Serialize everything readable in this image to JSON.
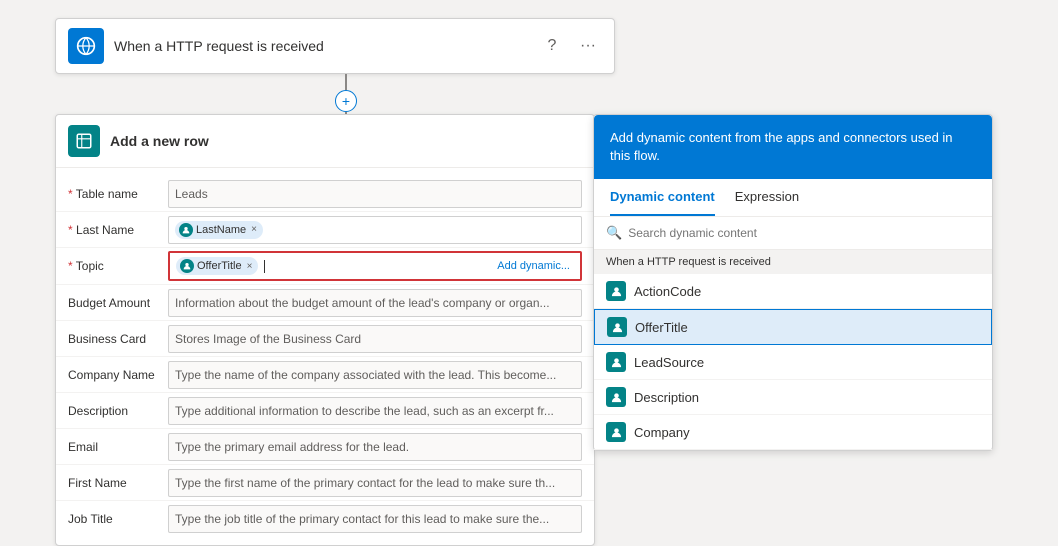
{
  "trigger": {
    "title": "When a HTTP request is received",
    "help_btn": "?",
    "more_btn": "···"
  },
  "add_row": {
    "title": "Add a new row",
    "fields": [
      {
        "label": "Table name",
        "required": true,
        "type": "text",
        "value": "Leads"
      },
      {
        "label": "Last Name",
        "required": true,
        "type": "tag",
        "tag": "LastName"
      },
      {
        "label": "Topic",
        "required": true,
        "type": "tag_active",
        "tag": "OfferTitle",
        "add_dynamic": "Add dynamic..."
      },
      {
        "label": "Budget Amount",
        "required": false,
        "type": "text",
        "value": "Information about the budget amount of the lead's company or organ..."
      },
      {
        "label": "Business Card",
        "required": false,
        "type": "text",
        "value": "Stores Image of the Business Card"
      },
      {
        "label": "Company Name",
        "required": false,
        "type": "text",
        "value": "Type the name of the company associated with the lead. This become..."
      },
      {
        "label": "Description",
        "required": false,
        "type": "text",
        "value": "Type additional information to describe the lead, such as an excerpt fr..."
      },
      {
        "label": "Email",
        "required": false,
        "type": "text",
        "value": "Type the primary email address for the lead."
      },
      {
        "label": "First Name",
        "required": false,
        "type": "text",
        "value": "Type the first name of the primary contact for the lead to make sure th..."
      },
      {
        "label": "Job Title",
        "required": false,
        "type": "text",
        "value": "Type the job title of the primary contact for this lead to make sure the..."
      }
    ]
  },
  "dynamic_panel": {
    "header": "Add dynamic content from the apps and connectors used in this flow.",
    "tab_dynamic": "Dynamic content",
    "tab_expression": "Expression",
    "search_placeholder": "Search dynamic content",
    "section_label": "When a HTTP request is received",
    "items": [
      {
        "name": "ActionCode"
      },
      {
        "name": "OfferTitle",
        "highlighted": true
      },
      {
        "name": "LeadSource"
      },
      {
        "name": "Description"
      },
      {
        "name": "Company"
      }
    ]
  }
}
